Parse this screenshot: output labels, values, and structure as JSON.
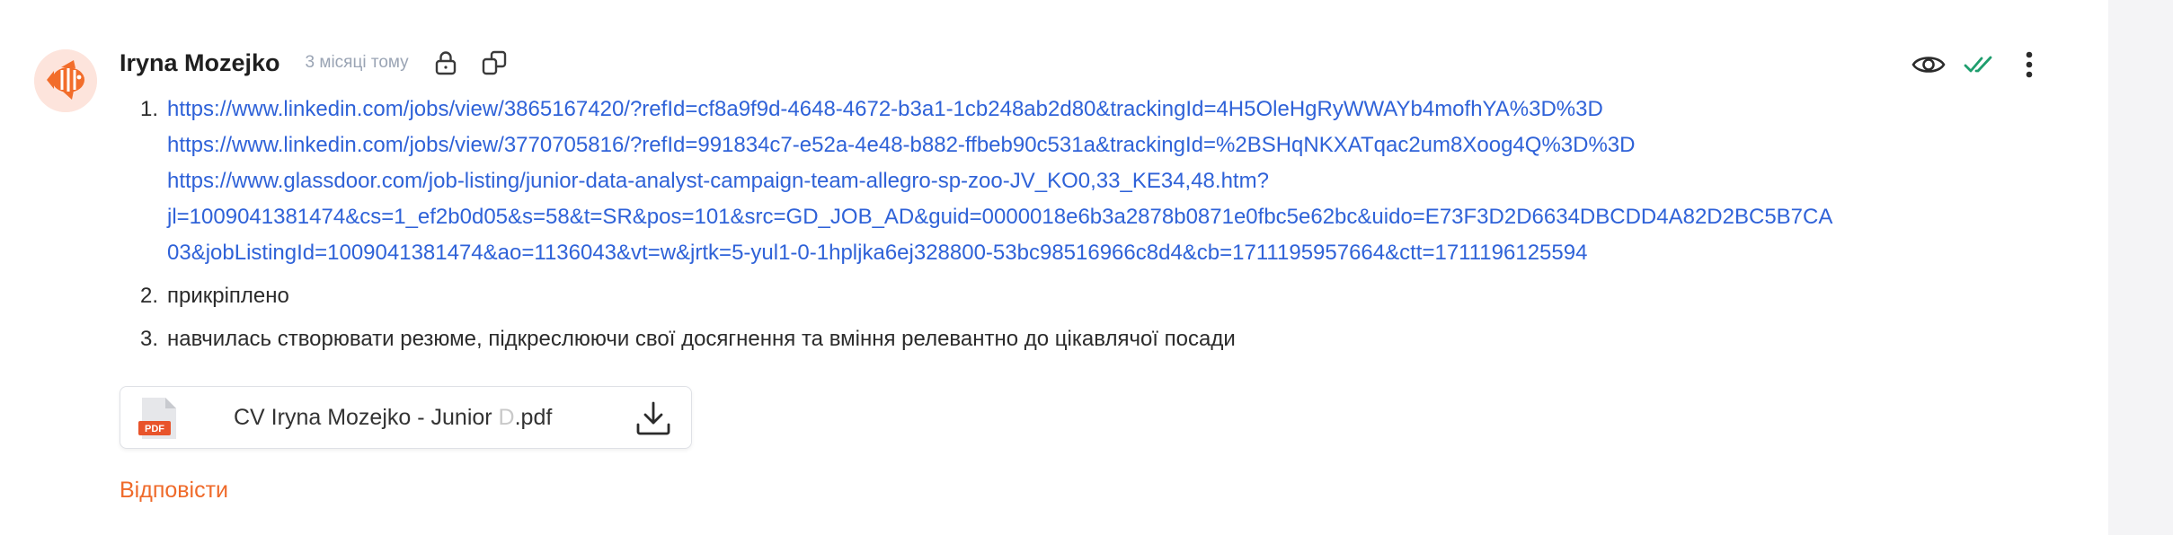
{
  "message": {
    "author": "Iryna Mozejko",
    "time": "3 місяці тому"
  },
  "list": [
    {
      "number": "1.",
      "links": [
        "https://www.linkedin.com/jobs/view/3865167420/?refId=cf8a9f9d-4648-4672-b3a1-1cb248ab2d80&trackingId=4H5OleHgRyWWAYb4mofhYA%3D%3D",
        "https://www.linkedin.com/jobs/view/3770705816/?refId=991834c7-e52a-4e48-b882-ffbeb90c531a&trackingId=%2BSHqNKXATqac2um8Xoog4Q%3D%3D",
        "https://www.glassdoor.com/job-listing/junior-data-analyst-campaign-team-allegro-sp-zoo-JV_KO0,33_KE34,48.htm?",
        "jl=1009041381474&cs=1_ef2b0d05&s=58&t=SR&pos=101&src=GD_JOB_AD&guid=0000018e6b3a2878b0871e0fbc5e62bc&uido=E73F3D2D6634DBCDD4A82D2BC5B7CA",
        "03&jobListingId=1009041381474&ao=1136043&vt=w&jrtk=5-yul1-0-1hpljka6ej328800-53bc98516966c8d4&cb=1711195957664&ctt=1711196125594"
      ]
    },
    {
      "number": "2.",
      "text": "прикріплено"
    },
    {
      "number": "3.",
      "text": "навчилась створювати резюме, підкреслюючи свої досягнення та вміння релевантно до цікавлячої посади"
    }
  ],
  "attachment": {
    "badge": "PDF",
    "name_start": "CV Iryna Mozejko - Junior",
    "name_faded": " D",
    "name_ext": ".pdf"
  },
  "reply_label": "Відповісти",
  "colors": {
    "link": "#2f62d8",
    "accent": "#ef6a2a",
    "read_check": "#1f9e6e",
    "timestamp": "#9aa4b4"
  },
  "icons": {
    "lock": "lock-icon",
    "copy": "copy-link-icon",
    "eye": "eye-icon",
    "read": "double-check-icon",
    "menu": "more-vertical-icon",
    "download": "download-icon"
  }
}
